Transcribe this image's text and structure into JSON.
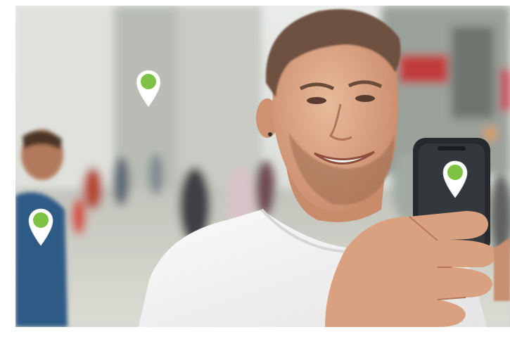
{
  "scene": {
    "subject": "photo-street-man-smartphone",
    "pin_icon": "map-pin-icon"
  },
  "colors": {
    "page_background": "#ffffff",
    "pin_body": "#ffffff",
    "pin_dot": "#7dc242",
    "shirt": "#f4f4f4",
    "skin": "#d9a17f",
    "hair": "#6e5140",
    "phone": "#262a2e",
    "street_blur": "#c9ccc6"
  },
  "pins": [
    {
      "id": "pin-building",
      "icon": "map-pin-icon"
    },
    {
      "id": "pin-left-person",
      "icon": "map-pin-icon"
    },
    {
      "id": "pin-phone",
      "icon": "map-pin-icon"
    }
  ]
}
